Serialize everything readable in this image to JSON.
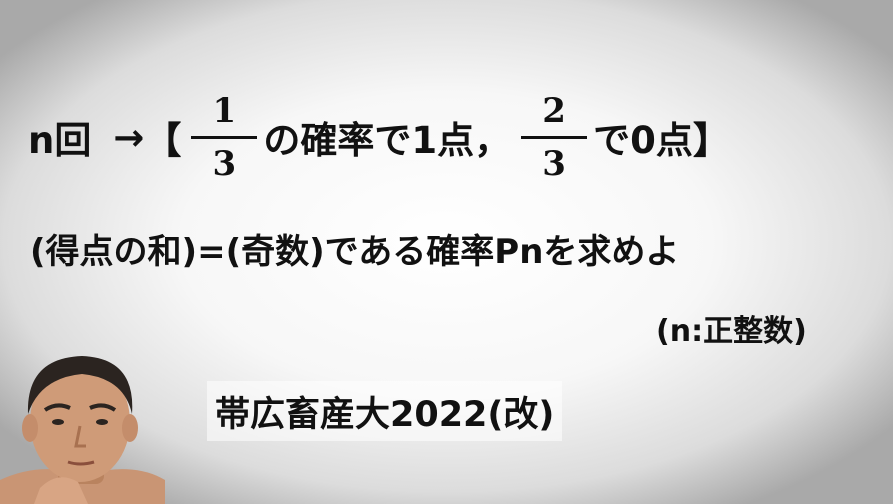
{
  "problem": {
    "n_label": "n回",
    "arrow": "→",
    "bracket_open": "【",
    "frac1": {
      "num": "1",
      "den": "3"
    },
    "text1": "の確率で1点",
    "comma": "，",
    "frac2": {
      "num": "2",
      "den": "3"
    },
    "text2": "で0点",
    "bracket_close": "】"
  },
  "question": "(得点の和)=(奇数)である確率Pnを求めよ",
  "condition": "(n:正整数)",
  "source": "帯広畜産大2022(改)",
  "colors": {
    "text": "#111111",
    "background_center": "#ffffff",
    "background_edge": "#a9a9a9"
  }
}
